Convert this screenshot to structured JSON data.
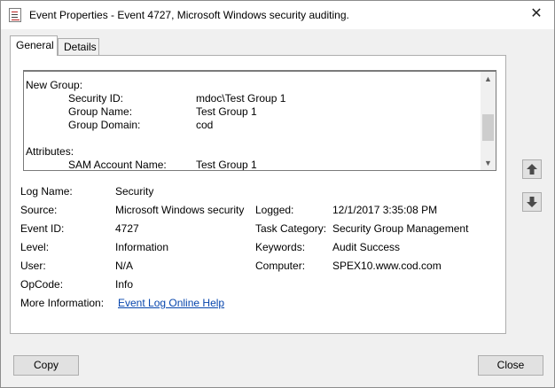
{
  "window": {
    "title": "Event Properties - Event 4727, Microsoft Windows security auditing.",
    "close_glyph": "✕"
  },
  "tabs": [
    {
      "label": "General",
      "active": true
    },
    {
      "label": "Details",
      "active": false
    }
  ],
  "description": {
    "lines": [
      {
        "key": "New Group:",
        "value": "",
        "heading": true
      },
      {
        "key": "Security ID:",
        "value": "mdoc\\Test Group 1",
        "heading": false
      },
      {
        "key": "Group Name:",
        "value": "Test Group 1",
        "heading": false
      },
      {
        "key": "Group Domain:",
        "value": "cod",
        "heading": false
      },
      {
        "key": "",
        "value": "",
        "heading": false
      },
      {
        "key": "Attributes:",
        "value": "",
        "heading": true
      },
      {
        "key": "SAM Account Name:",
        "value": "Test Group 1",
        "heading": false
      }
    ],
    "scroll_up_glyph": "▲",
    "scroll_down_glyph": "▼"
  },
  "fields": {
    "log_name": {
      "label": "Log Name:",
      "value": "Security"
    },
    "source": {
      "label": "Source:",
      "value": "Microsoft Windows security"
    },
    "logged": {
      "label": "Logged:",
      "value": "12/1/2017 3:35:08 PM"
    },
    "event_id": {
      "label": "Event ID:",
      "value": "4727"
    },
    "task_category": {
      "label": "Task Category:",
      "value": "Security Group Management"
    },
    "level": {
      "label": "Level:",
      "value": "Information"
    },
    "keywords": {
      "label": "Keywords:",
      "value": "Audit Success"
    },
    "user": {
      "label": "User:",
      "value": "N/A"
    },
    "computer": {
      "label": "Computer:",
      "value": "SPEX10.www.cod.com"
    },
    "opcode": {
      "label": "OpCode:",
      "value": "Info"
    },
    "more_info": {
      "label": "More Information:",
      "link": "Event Log Online Help"
    }
  },
  "buttons": {
    "copy": "Copy",
    "close": "Close"
  },
  "icons": {
    "title": "event-document-icon",
    "prev": "arrow-up-icon",
    "next": "arrow-down-icon"
  }
}
